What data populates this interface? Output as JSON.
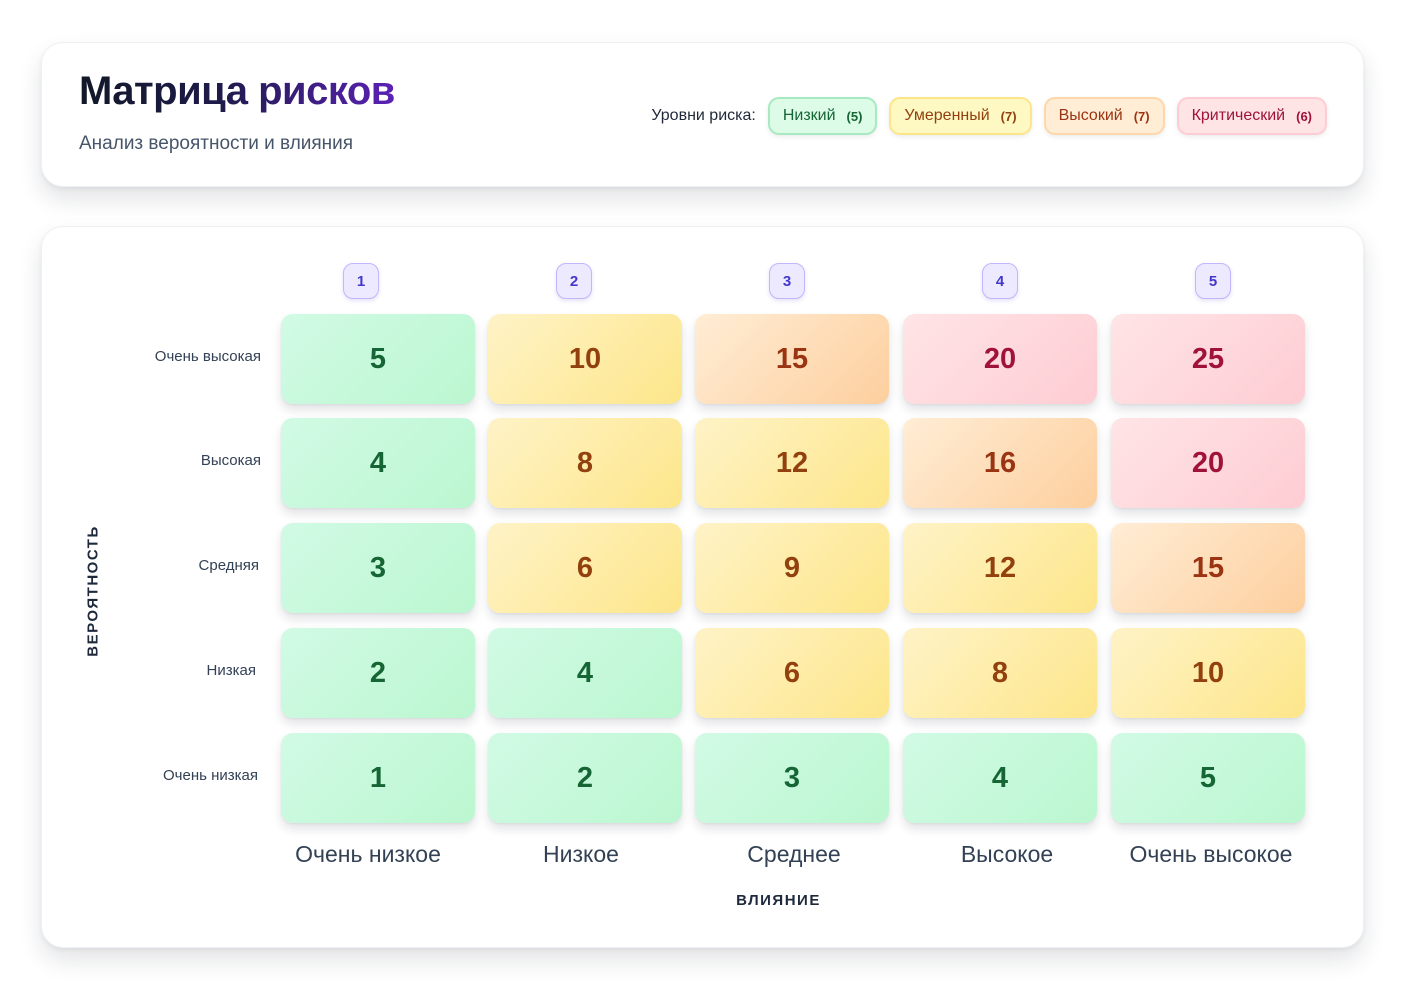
{
  "header": {
    "title": "Матрица рисков",
    "subtitle": "Анализ вероятности и влияния"
  },
  "legend": {
    "label": "Уровни риска:",
    "items": [
      {
        "label": "Низкий",
        "count": "(5)",
        "level": "low"
      },
      {
        "label": "Умеренный",
        "count": "(7)",
        "level": "moderate"
      },
      {
        "label": "Высокий",
        "count": "(7)",
        "level": "high"
      },
      {
        "label": "Критический",
        "count": "(6)",
        "level": "critical"
      }
    ]
  },
  "colors": {
    "low": "#bbf7d0",
    "moderate": "#fde68a",
    "high": "#fdcf9e",
    "critical": "#fecdd3",
    "accent": "#4338ca"
  },
  "matrix": {
    "x_axis_title": "ВЛИЯНИЕ",
    "y_axis_title": "ВЕРОЯТНОСТЬ",
    "column_numbers": [
      "1",
      "2",
      "3",
      "4",
      "5"
    ],
    "column_labels": [
      "Очень низкое",
      "Низкое",
      "Среднее",
      "Высокое",
      "Очень высокое"
    ],
    "row_labels": [
      "Очень высокая",
      "Высокая",
      "Средняя",
      "Низкая",
      "Очень низкая"
    ],
    "rows": [
      [
        {
          "value": "5",
          "level": "low"
        },
        {
          "value": "10",
          "level": "moderate"
        },
        {
          "value": "15",
          "level": "high"
        },
        {
          "value": "20",
          "level": "critical"
        },
        {
          "value": "25",
          "level": "critical"
        }
      ],
      [
        {
          "value": "4",
          "level": "low"
        },
        {
          "value": "8",
          "level": "moderate"
        },
        {
          "value": "12",
          "level": "moderate"
        },
        {
          "value": "16",
          "level": "high"
        },
        {
          "value": "20",
          "level": "critical"
        }
      ],
      [
        {
          "value": "3",
          "level": "low"
        },
        {
          "value": "6",
          "level": "moderate"
        },
        {
          "value": "9",
          "level": "moderate"
        },
        {
          "value": "12",
          "level": "moderate"
        },
        {
          "value": "15",
          "level": "high"
        }
      ],
      [
        {
          "value": "2",
          "level": "low"
        },
        {
          "value": "4",
          "level": "low"
        },
        {
          "value": "6",
          "level": "moderate"
        },
        {
          "value": "8",
          "level": "moderate"
        },
        {
          "value": "10",
          "level": "moderate"
        }
      ],
      [
        {
          "value": "1",
          "level": "low"
        },
        {
          "value": "2",
          "level": "low"
        },
        {
          "value": "3",
          "level": "low"
        },
        {
          "value": "4",
          "level": "low"
        },
        {
          "value": "5",
          "level": "low"
        }
      ]
    ]
  }
}
